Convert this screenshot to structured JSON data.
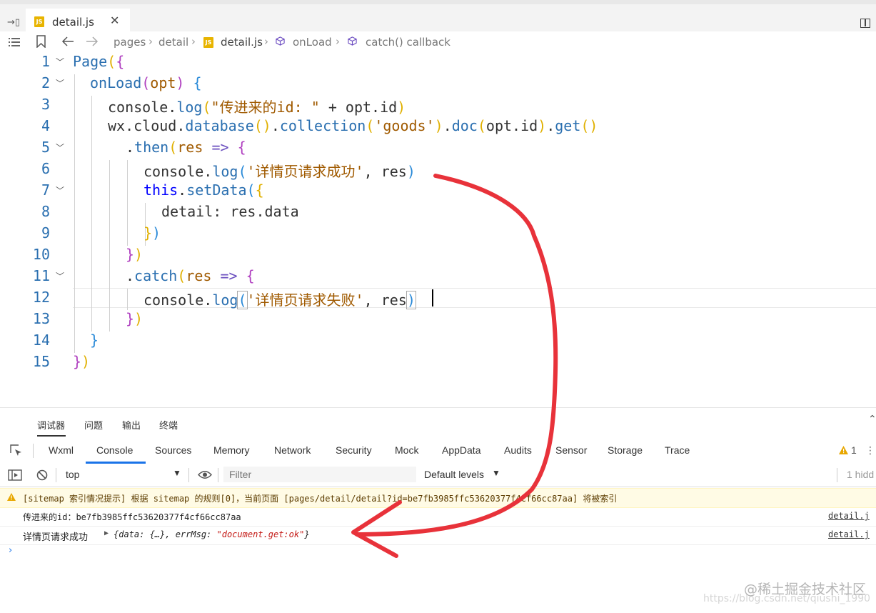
{
  "tab": {
    "label": "detail.js",
    "close": "✕",
    "js_badge": "JS"
  },
  "breadcrumb": {
    "items": [
      "pages",
      "detail",
      "detail.js",
      "onLoad",
      "catch() callback"
    ],
    "separator": "›"
  },
  "editor": {
    "line_numbers": [
      "1",
      "2",
      "3",
      "4",
      "5",
      "6",
      "7",
      "8",
      "9",
      "10",
      "11",
      "12",
      "13",
      "14",
      "15"
    ],
    "tokens": {
      "page": "Page",
      "onload": "onLoad",
      "opt": "opt",
      "console": "console",
      "log": "log",
      "wx": "wx",
      "cloud": "cloud",
      "database": "database",
      "collection": "collection",
      "doc": "doc",
      "get": "get",
      "then": "then",
      "catch": "catch",
      "res": "res",
      "arrow": "=>",
      "this": "this",
      "setData": "setData",
      "detail": "detail",
      "data": "data",
      "str_id": "\"传进来的id: \"",
      "str_goods": "'goods'",
      "str_success": "'详情页请求成功'",
      "str_fail": "'详情页请求失败'",
      "id": "id"
    }
  },
  "panel": {
    "tabs": [
      "调试器",
      "问题",
      "输出",
      "终端"
    ],
    "devtools_tabs": [
      "Wxml",
      "Console",
      "Sources",
      "Memory",
      "Network",
      "Security",
      "Mock",
      "AppData",
      "Audits",
      "Sensor",
      "Storage",
      "Trace"
    ],
    "warning_count": "1",
    "context": "top",
    "filter_placeholder": "Filter",
    "levels": "Default levels",
    "hidden_label": "1 hidd"
  },
  "console": {
    "warning": "[sitemap 索引情况提示] 根据 sitemap 的规则[0]，当前页面 [pages/detail/detail?id=be7fb3985ffc53620377f4cf66cc87aa] 将被索引",
    "log1": "传进来的id：be7fb3985ffc53620377f4cf66cc87aa",
    "log2_label": "详情页请求成功",
    "log2_obj_start": "{data: {…}, errMsg: ",
    "log2_obj_str": "\"document.get:ok\"",
    "log2_obj_end": "}",
    "source": "detail.j"
  },
  "watermark": {
    "brand": "@稀土掘金技术社区",
    "url": "https://blog.csdn.net/qiushi_1990"
  },
  "colors": {
    "console_tab_accent": "#1a73e8",
    "annotation_arrow": "#e8323a",
    "warning_bg": "#fffbe5"
  }
}
